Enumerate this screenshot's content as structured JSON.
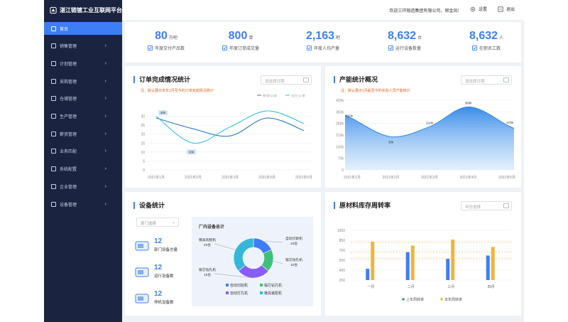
{
  "brand": {
    "title": "湛江链镀工业互联网平台"
  },
  "topbar": {
    "welcome": "欢迎三环锻造集团有限公司，郭金凤!",
    "settings": "设置",
    "logout": "退出"
  },
  "sidebar": {
    "items": [
      {
        "label": "首页",
        "active": true,
        "has_arrow": false
      },
      {
        "label": "销售管理",
        "has_arrow": true
      },
      {
        "label": "计划管理",
        "has_arrow": true
      },
      {
        "label": "采购管理",
        "has_arrow": true
      },
      {
        "label": "仓储管理",
        "has_arrow": true
      },
      {
        "label": "生产管理",
        "has_arrow": true
      },
      {
        "label": "薪资管理",
        "has_arrow": true
      },
      {
        "label": "业务匹配",
        "has_arrow": true
      },
      {
        "label": "系统配置",
        "has_arrow": true
      },
      {
        "label": "企业管理",
        "has_arrow": true
      },
      {
        "label": "设备管理",
        "has_arrow": true
      }
    ]
  },
  "kpis": [
    {
      "value": "80",
      "unit": "万吧",
      "label": "年度交付产品数"
    },
    {
      "value": "800",
      "unit": "单",
      "label": "年度订单成交量"
    },
    {
      "value": "2,163",
      "unit": "吧",
      "label": "年度人均产量"
    },
    {
      "value": "8,632",
      "unit": "台",
      "label": "运行设备数量"
    },
    {
      "value": "8,632",
      "unit": "人",
      "label": "在职员工数"
    }
  ],
  "orders": {
    "title": "订单完成情况统计",
    "date_placeholder": "请选择日期",
    "note": "注：默认展示本年1月至今的订单完成情况统计"
  },
  "capacity": {
    "title": "产能统计概况",
    "date_placeholder": "请选择日期",
    "note": "注：默认展示1月起至今的实际人员产能统计"
  },
  "devices": {
    "title": "设备统计",
    "select_placeholder": "部门选择",
    "stats": [
      {
        "value": "12",
        "label": "部门设备总量"
      },
      {
        "value": "12",
        "label": "运行设备数"
      },
      {
        "value": "12",
        "label": "停机设备数"
      }
    ],
    "factory_title": "厂内设备总计"
  },
  "turnover": {
    "title": "原材料库存周转率",
    "year_placeholder": "年份选择"
  },
  "colors": {
    "accent": "#3d7ef7",
    "sidebar_bg": "#1a2340",
    "note": "#e0601a",
    "bar_last": "#3d7ef7",
    "bar_this": "#f1b43a",
    "donut1": "#3d7ef7",
    "donut2": "#3dc07a",
    "donut3": "#8a5cf6",
    "donut4": "#35b8d8"
  },
  "chart_data": [
    {
      "type": "line",
      "chart": "orders",
      "x": [
        "2021年1月",
        "2021年2月",
        "2021年3月",
        "2021年4月",
        "2021年5月"
      ],
      "series": [
        {
          "name": "新增订单",
          "values": [
            29,
            23,
            19,
            29,
            22
          ]
        },
        {
          "name": "交付订单",
          "values": [
            30,
            15,
            24,
            33,
            26
          ]
        }
      ],
      "annotations": [
        {
          "text": "30k"
        },
        {
          "text": "30k"
        }
      ],
      "yticks": [
        0,
        5,
        10,
        15,
        20,
        25,
        30
      ],
      "ylim": [
        0,
        35
      ]
    },
    {
      "type": "area",
      "chart": "capacity",
      "x": [
        "2021年1月",
        "2021年2月",
        "2021年3月",
        "2021年4月",
        "2021年5月"
      ],
      "values": [
        310,
        200,
        260,
        380,
        270
      ],
      "data_labels": [
        "310k",
        "30k",
        "210k",
        "380k",
        "270k"
      ],
      "yticks": [
        "0",
        "70k",
        "140k",
        "210k",
        "280k",
        "350k",
        "420k"
      ],
      "ylim": [
        0,
        420
      ]
    },
    {
      "type": "pie",
      "chart": "factory_devices",
      "slices": [
        {
          "name": "自动切割机",
          "value": 10,
          "label": "自动切割机\n10台"
        },
        {
          "name": "锻芯钻孔机",
          "value": 10,
          "label": "锻芯钻孔机\n10台"
        },
        {
          "name": "自动打孔机",
          "value": 15,
          "label": "锻芯钻孔机\n15台"
        },
        {
          "name": "镀具装配机",
          "value": 20,
          "label": "镀具装配机\n20台"
        }
      ]
    },
    {
      "type": "bar",
      "chart": "turnover",
      "categories": [
        "一月",
        "二月",
        "三月",
        "四月"
      ],
      "series": [
        {
          "name": "上年周转率",
          "values": [
            420,
            670,
            570,
            620
          ]
        },
        {
          "name": "本年周转率",
          "values": [
            830,
            770,
            860,
            750
          ]
        }
      ],
      "yticks": [
        250,
        400,
        550,
        700,
        850,
        1000
      ],
      "ylim": [
        250,
        1000
      ],
      "reference_lines": [
        580,
        670,
        820
      ]
    }
  ]
}
